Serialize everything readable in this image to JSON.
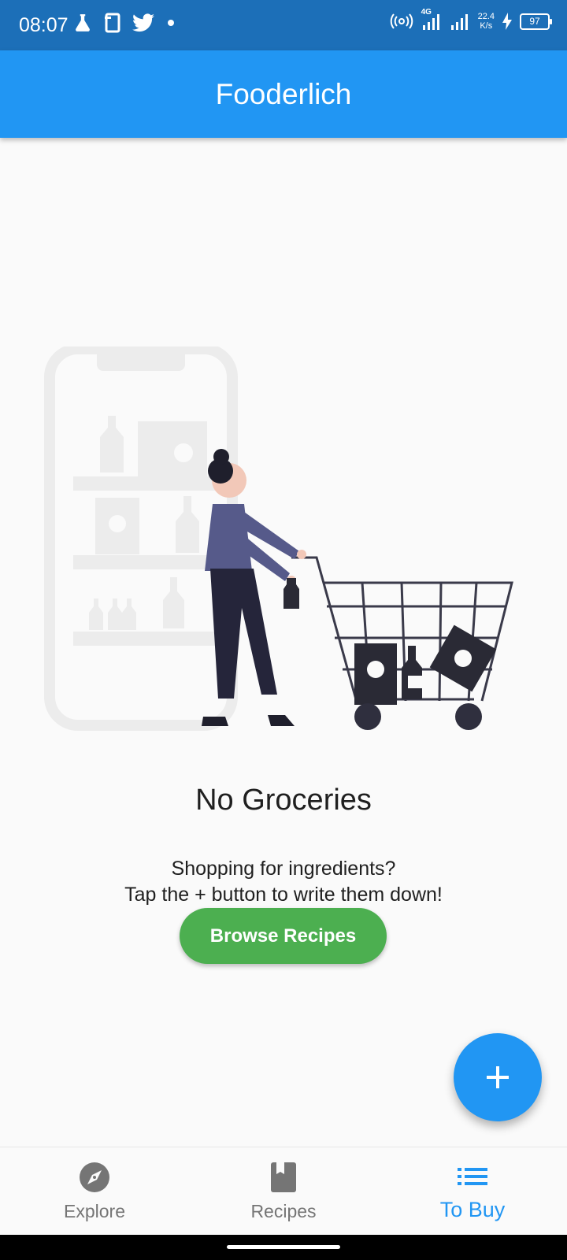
{
  "status_bar": {
    "time": "08:07",
    "network": "4G",
    "speed_value": "22.4",
    "speed_unit": "K/s",
    "battery": "97",
    "icons": [
      "lab-flask-icon",
      "phone-frame-icon",
      "twitter-icon",
      "dot-icon",
      "hotspot-icon",
      "signal-icon",
      "charging-icon",
      "battery-icon"
    ]
  },
  "app_bar": {
    "title": "Fooderlich"
  },
  "empty_state": {
    "illustration": "shopping-cart-illustration",
    "title": "No Groceries",
    "subtitle_line1": "Shopping for ingredients?",
    "subtitle_line2": "Tap the + button to write them down!",
    "button_label": "Browse Recipes"
  },
  "fab": {
    "icon": "plus-icon"
  },
  "bottom_nav": {
    "items": [
      {
        "label": "Explore",
        "icon": "compass-icon",
        "active": false
      },
      {
        "label": "Recipes",
        "icon": "book-icon",
        "active": false
      },
      {
        "label": "To Buy",
        "icon": "list-icon",
        "active": true
      }
    ]
  },
  "colors": {
    "primary": "#2196f3",
    "status_bar": "#1c6fb8",
    "button_green": "#4caf50",
    "inactive_nav": "#757575"
  }
}
